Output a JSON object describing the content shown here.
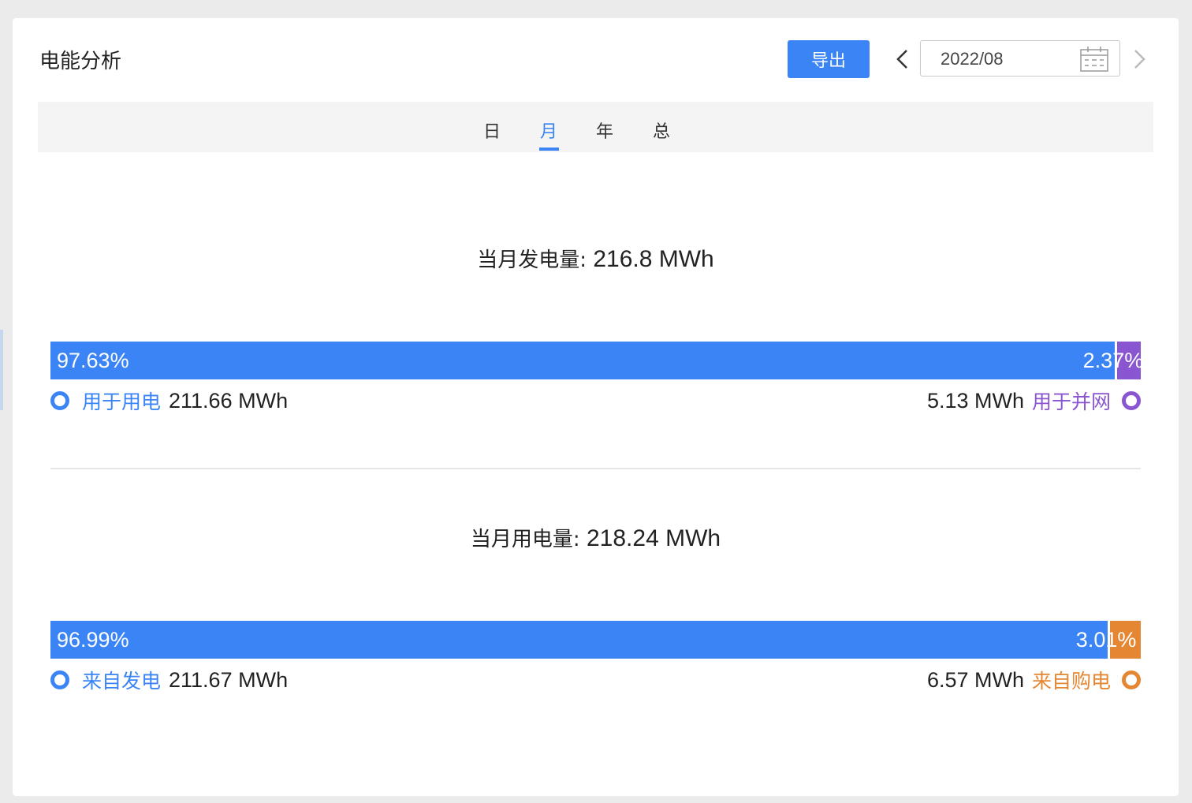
{
  "header": {
    "title": "电能分析",
    "export_label": "导出",
    "date_value": "2022/08"
  },
  "tabs": [
    {
      "label": "日",
      "active": false
    },
    {
      "label": "月",
      "active": true
    },
    {
      "label": "年",
      "active": false
    },
    {
      "label": "总",
      "active": false
    }
  ],
  "generation": {
    "title_label": "当月发电量:",
    "title_value": "216.8 MWh",
    "left_pct": "97.63%",
    "right_pct": "2.37%",
    "left_fraction": 0.9763,
    "left_label": "用于用电",
    "left_value": "211.66 MWh",
    "right_value": "5.13 MWh",
    "right_label": "用于并网",
    "left_color": "#3a84f5",
    "right_color": "#8a55d0"
  },
  "consumption": {
    "title_label": "当月用电量:",
    "title_value": "218.24 MWh",
    "left_pct": "96.99%",
    "right_pct": "3.01%",
    "left_fraction": 0.9699,
    "left_label": "来自发电",
    "left_value": "211.67 MWh",
    "right_value": "6.57 MWh",
    "right_label": "来自购电",
    "left_color": "#3a84f5",
    "right_color": "#e58632"
  },
  "icons": {
    "prev": "chevron-left-icon",
    "next": "chevron-right-icon",
    "calendar": "calendar-icon"
  }
}
